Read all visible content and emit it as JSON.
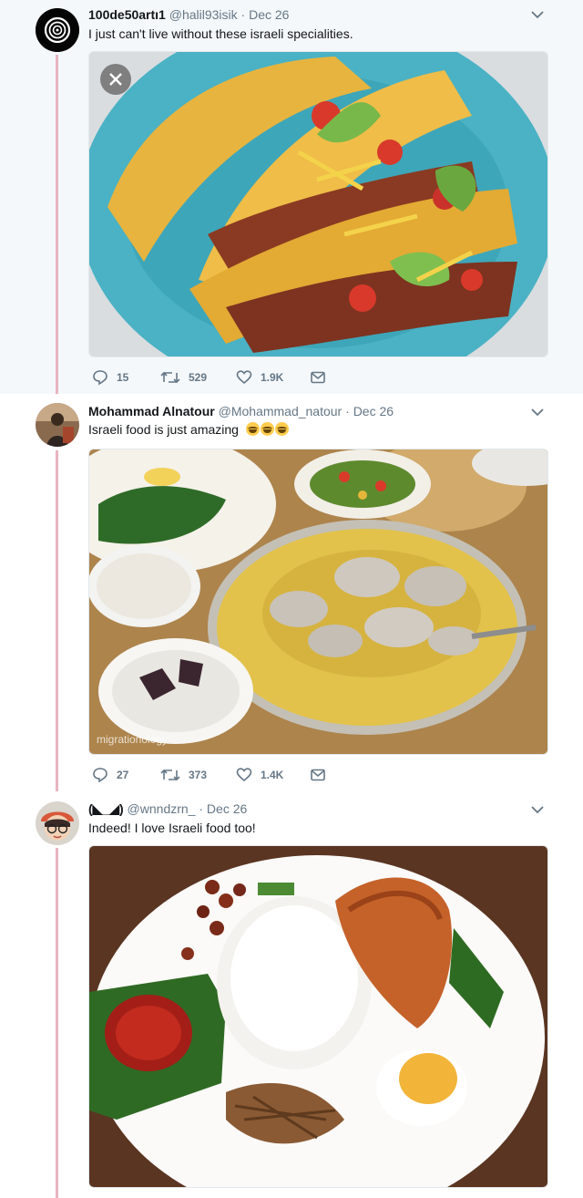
{
  "tweets": [
    {
      "name": "100de50artı1",
      "handle": "@halil93isik",
      "separator": "·",
      "date": "Dec 26",
      "text": "I just can't live without these israeli specialities.",
      "replies": "15",
      "retweets": "529",
      "likes": "1.9K"
    },
    {
      "name": "Mohammad Alnatour",
      "handle": "@Mohammad_natour",
      "separator": "·",
      "date": "Dec 26",
      "text": "Israeli food is just amazing",
      "emoji": "joy-emoji x3",
      "replies": "27",
      "retweets": "373",
      "likes": "1.4K",
      "watermark": "migrationology"
    },
    {
      "name": "(◣_◢)",
      "handle": "@wnndzrn_",
      "separator": "·",
      "date": "Dec 26",
      "text": "Indeed! I love Israeli food too!"
    }
  ],
  "colors": {
    "thread_line": "#e8b4c0",
    "selected_bg": "#f5f8fa",
    "muted": "#657786"
  }
}
